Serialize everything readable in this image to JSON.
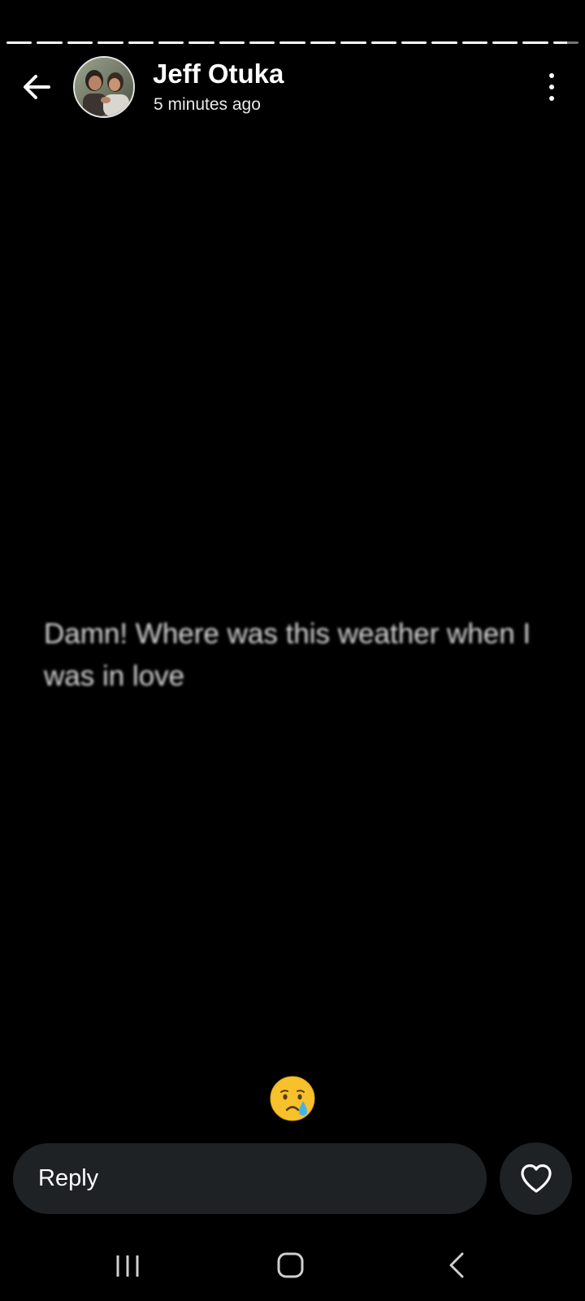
{
  "story": {
    "segments_total": 19,
    "segments_complete": 18,
    "current_segment_progress": 0.55
  },
  "header": {
    "name": "Jeff Otuka",
    "time": "5 minutes ago",
    "back_icon": "arrow-left-icon",
    "more_icon": "more-vertical-icon"
  },
  "status": {
    "text": "Damn! Where was this weather when I was in love"
  },
  "reaction": {
    "emoji": "😢",
    "icon": "crying-face-icon"
  },
  "reply": {
    "placeholder": "Reply",
    "like_icon": "heart-outline-icon"
  },
  "system_nav": {
    "recents_icon": "recents-icon",
    "home_icon": "home-icon",
    "back_icon": "back-chevron-icon"
  },
  "colors": {
    "background": "#000000",
    "input_bg": "#1f2225",
    "text": "#ffffff"
  }
}
